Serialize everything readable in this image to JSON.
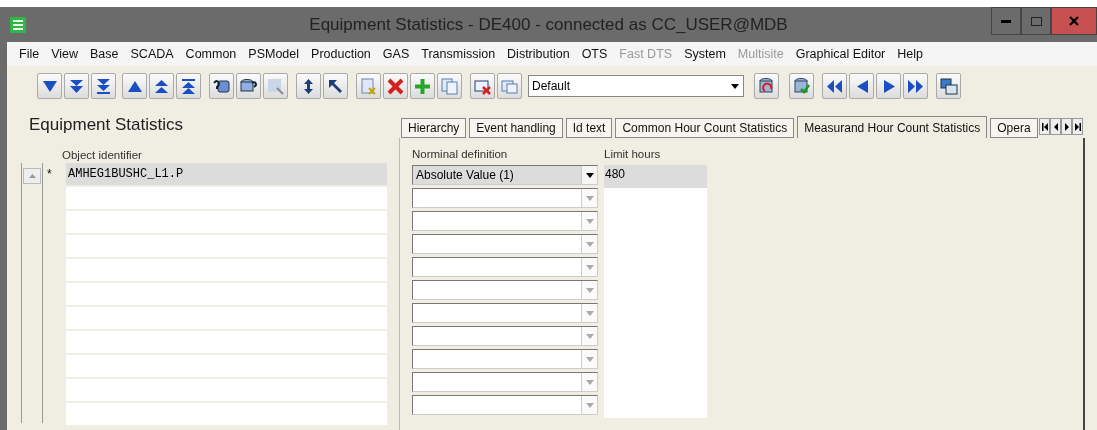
{
  "window": {
    "title": "Equipment Statistics - DE400 - connected as CC_USER@MDB"
  },
  "menu": [
    {
      "label": "File",
      "disabled": false
    },
    {
      "label": "View",
      "disabled": false
    },
    {
      "label": "Base",
      "disabled": false
    },
    {
      "label": "SCADA",
      "disabled": false
    },
    {
      "label": "Common",
      "disabled": false
    },
    {
      "label": "PSModel",
      "disabled": false
    },
    {
      "label": "Production",
      "disabled": false
    },
    {
      "label": "GAS",
      "disabled": false
    },
    {
      "label": "Transmission",
      "disabled": false
    },
    {
      "label": "Distribution",
      "disabled": false
    },
    {
      "label": "OTS",
      "disabled": false
    },
    {
      "label": "Fast DTS",
      "disabled": true
    },
    {
      "label": "System",
      "disabled": false
    },
    {
      "label": "Multisite",
      "disabled": true
    },
    {
      "label": "Graphical Editor",
      "disabled": false
    },
    {
      "label": "Help",
      "disabled": false
    }
  ],
  "toolbar": {
    "filter_select": {
      "value": "Default"
    }
  },
  "panel": {
    "title": "Equipment Statistics",
    "column": "Object identifier",
    "marker": "*",
    "rows": [
      {
        "identifier": "AMHEG1BUSHC_L1.P",
        "selected": true
      },
      {
        "selected": false
      },
      {
        "selected": false
      },
      {
        "selected": false
      },
      {
        "selected": false
      },
      {
        "selected": false
      },
      {
        "selected": false
      },
      {
        "selected": false
      },
      {
        "selected": false
      },
      {
        "selected": false
      },
      {
        "selected": false
      }
    ]
  },
  "tabs": [
    {
      "label": "Hierarchy",
      "selected": false
    },
    {
      "label": "Event handling",
      "selected": false
    },
    {
      "label": "Id text",
      "selected": false
    },
    {
      "label": "Common Hour Count Statistics",
      "selected": false
    },
    {
      "label": "Measurand Hour Count Statistics",
      "selected": true
    },
    {
      "label": "Opera",
      "selected": false
    }
  ],
  "detail": {
    "columns": [
      "Norminal definition",
      "Limit hours"
    ],
    "rows": [
      {
        "definition": "Absolute Value (1)",
        "limit": "480",
        "selected": true
      },
      {
        "selected": false
      },
      {
        "selected": false
      },
      {
        "selected": false
      },
      {
        "selected": false
      },
      {
        "selected": false
      },
      {
        "selected": false
      },
      {
        "selected": false
      },
      {
        "selected": false
      },
      {
        "selected": false
      },
      {
        "selected": false
      }
    ]
  }
}
